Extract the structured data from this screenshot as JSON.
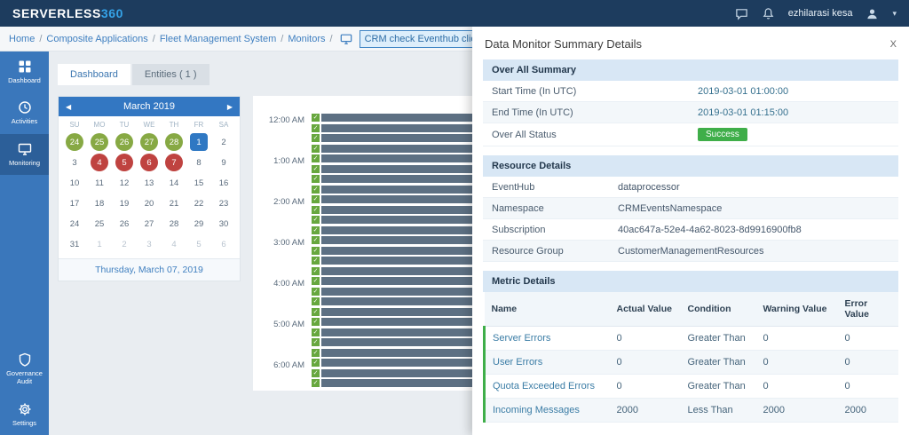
{
  "colors": {
    "topbar_bg": "#1d3c5e",
    "accent_blue": "#3377c2",
    "sidebar_bg": "#3a77bb",
    "success_green": "#3fae49",
    "alert_red": "#bf4340",
    "day_green": "#87a944",
    "timeline_bar": "#5d7083"
  },
  "topbar": {
    "logo_main": "SERVERLESS",
    "logo_accent": "360",
    "user": "ezhilarasi kesa"
  },
  "breadcrumb": {
    "items": [
      "Home",
      "Composite Applications",
      "Fleet Management System",
      "Monitors"
    ],
    "separator": "/",
    "monitor_select": "CRM check Eventhub client connectio",
    "select_caret": "▼"
  },
  "sidebar": {
    "items": [
      {
        "id": "dashboard",
        "label": "Dashboard",
        "active": false
      },
      {
        "id": "activities",
        "label": "Activities",
        "active": false
      },
      {
        "id": "monitoring",
        "label": "Monitoring",
        "active": true
      },
      {
        "id": "governance-audit",
        "label": "Governance Audit",
        "active": false
      },
      {
        "id": "settings",
        "label": "Settings",
        "active": false
      }
    ]
  },
  "main": {
    "tabs": [
      {
        "label": "Dashboard",
        "active": true
      },
      {
        "label": "Entities ( 1 )",
        "active": false
      }
    ],
    "calendar": {
      "month": "March 2019",
      "prev": "◀",
      "next": "▶",
      "day_names": [
        "SU",
        "MO",
        "TU",
        "WE",
        "TH",
        "FR",
        "SA"
      ],
      "weeks": [
        [
          {
            "d": "24",
            "s": "green"
          },
          {
            "d": "25",
            "s": "green"
          },
          {
            "d": "26",
            "s": "green"
          },
          {
            "d": "27",
            "s": "green"
          },
          {
            "d": "28",
            "s": "green"
          },
          {
            "d": "1",
            "s": "selected"
          },
          {
            "d": "2",
            "s": "normal"
          }
        ],
        [
          {
            "d": "3",
            "s": "normal"
          },
          {
            "d": "4",
            "s": "red"
          },
          {
            "d": "5",
            "s": "red"
          },
          {
            "d": "6",
            "s": "red"
          },
          {
            "d": "7",
            "s": "red"
          },
          {
            "d": "8",
            "s": "normal"
          },
          {
            "d": "9",
            "s": "normal"
          }
        ],
        [
          {
            "d": "10",
            "s": "normal"
          },
          {
            "d": "11",
            "s": "normal"
          },
          {
            "d": "12",
            "s": "normal"
          },
          {
            "d": "13",
            "s": "normal"
          },
          {
            "d": "14",
            "s": "normal"
          },
          {
            "d": "15",
            "s": "normal"
          },
          {
            "d": "16",
            "s": "normal"
          }
        ],
        [
          {
            "d": "17",
            "s": "normal"
          },
          {
            "d": "18",
            "s": "normal"
          },
          {
            "d": "19",
            "s": "normal"
          },
          {
            "d": "20",
            "s": "normal"
          },
          {
            "d": "21",
            "s": "normal"
          },
          {
            "d": "22",
            "s": "normal"
          },
          {
            "d": "23",
            "s": "normal"
          }
        ],
        [
          {
            "d": "24",
            "s": "normal"
          },
          {
            "d": "25",
            "s": "normal"
          },
          {
            "d": "26",
            "s": "normal"
          },
          {
            "d": "27",
            "s": "normal"
          },
          {
            "d": "28",
            "s": "normal"
          },
          {
            "d": "29",
            "s": "normal"
          },
          {
            "d": "30",
            "s": "normal"
          }
        ],
        [
          {
            "d": "31",
            "s": "normal"
          },
          {
            "d": "1",
            "s": "muted"
          },
          {
            "d": "2",
            "s": "muted"
          },
          {
            "d": "3",
            "s": "muted"
          },
          {
            "d": "4",
            "s": "muted"
          },
          {
            "d": "5",
            "s": "muted"
          },
          {
            "d": "6",
            "s": "muted"
          }
        ]
      ],
      "footer": "Thursday, March 07, 2019"
    },
    "timeline": {
      "hours": [
        "12:00 AM",
        "1:00 AM",
        "2:00 AM",
        "3:00 AM",
        "4:00 AM",
        "5:00 AM",
        "6:00 AM"
      ],
      "row_count": 27,
      "check": "✓"
    }
  },
  "panel": {
    "title": "Data Monitor Summary Details",
    "close_label": "X",
    "overall": {
      "title": "Over All Summary",
      "rows": [
        {
          "label": "Start Time (In UTC)",
          "value": "2019-03-01 01:00:00"
        },
        {
          "label": "End Time (In UTC)",
          "value": "2019-03-01 01:15:00"
        },
        {
          "label": "Over All Status",
          "value": "Success",
          "badge": true
        }
      ]
    },
    "resource": {
      "title": "Resource Details",
      "rows": [
        {
          "label": "EventHub",
          "value": "dataprocessor"
        },
        {
          "label": "Namespace",
          "value": "CRMEventsNamespace"
        },
        {
          "label": "Subscription",
          "value": "40ac647a-52e4-4a62-8023-8d9916900fb8"
        },
        {
          "label": "Resource Group",
          "value": "CustomerManagementResources"
        }
      ]
    },
    "metrics": {
      "title": "Metric Details",
      "columns": [
        "Name",
        "Actual Value",
        "Condition",
        "Warning Value",
        "Error Value"
      ],
      "rows": [
        [
          "Server Errors",
          "0",
          "Greater Than",
          "0",
          "0"
        ],
        [
          "User Errors",
          "0",
          "Greater Than",
          "0",
          "0"
        ],
        [
          "Quota Exceeded Errors",
          "0",
          "Greater Than",
          "0",
          "0"
        ],
        [
          "Incoming Messages",
          "2000",
          "Less Than",
          "2000",
          "2000"
        ]
      ]
    }
  }
}
